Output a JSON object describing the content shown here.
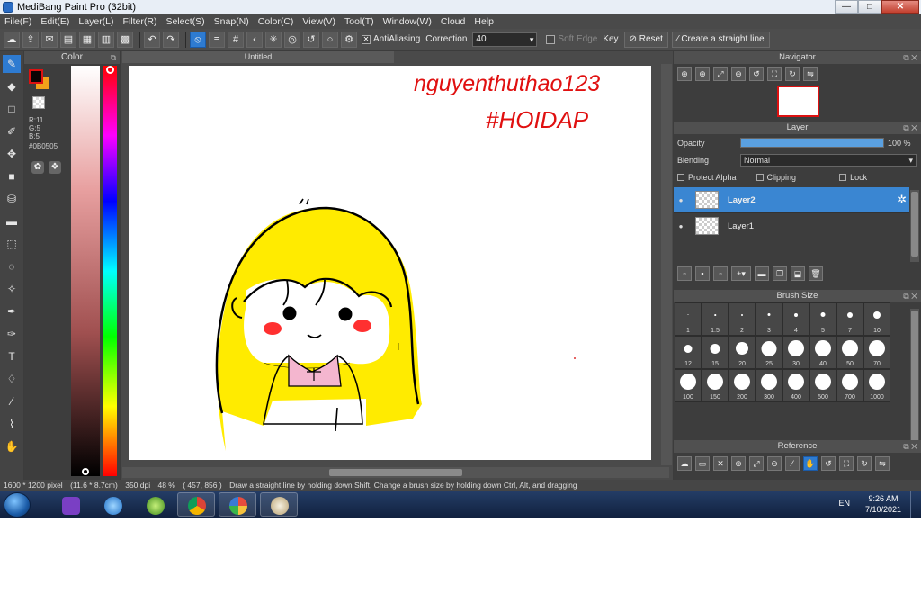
{
  "window": {
    "title": "MediBang Paint Pro (32bit)",
    "min": "—",
    "max": "□",
    "close": "✕"
  },
  "menu": [
    "File(F)",
    "Edit(E)",
    "Layer(L)",
    "Filter(R)",
    "Select(S)",
    "Snap(N)",
    "Color(C)",
    "View(V)",
    "Tool(T)",
    "Window(W)",
    "Cloud",
    "Help"
  ],
  "toolbar": {
    "antialiasing_label": "AntiAliasing",
    "correction_label": "Correction",
    "correction_value": "40",
    "soft_edge_label": "Soft Edge",
    "key_label": "Key",
    "reset_label": "Reset",
    "straight_line_label": "Create a straight line"
  },
  "color_panel": {
    "title": "Color",
    "r": "R:11",
    "g": "G:5",
    "b": "B:5",
    "hex": "#0B0505",
    "fg_color": "#0b0505",
    "bg_color": "#f2a21a"
  },
  "canvas": {
    "tab_title": "Untitled",
    "handwriting_line1": "nguyenthuthao123",
    "handwriting_line2": "#HOIDAP"
  },
  "navigator": {
    "title": "Navigator"
  },
  "layer_panel": {
    "title": "Layer",
    "opacity_label": "Opacity",
    "opacity_value": "100 %",
    "blending_label": "Blending",
    "blending_value": "Normal",
    "protect_alpha": "Protect Alpha",
    "clipping": "Clipping",
    "lock": "Lock",
    "layers": [
      {
        "name": "Layer2",
        "selected": true
      },
      {
        "name": "Layer1",
        "selected": false
      }
    ]
  },
  "brush_size": {
    "title": "Brush Size",
    "sizes": [
      "1",
      "1.5",
      "2",
      "3",
      "4",
      "5",
      "7",
      "10",
      "12",
      "15",
      "20",
      "25",
      "30",
      "40",
      "50",
      "70",
      "100",
      "150",
      "200",
      "300",
      "400",
      "500",
      "700",
      "1000"
    ]
  },
  "reference": {
    "title": "Reference"
  },
  "status": {
    "size": "1600 * 1200 pixel",
    "cm": "(11.6 * 8.7cm)",
    "dpi": "350 dpi",
    "zoom": "48 %",
    "coords": "( 457, 856 )",
    "hint": "Draw a straight line by holding down Shift, Change a brush size by holding down Ctrl, Alt, and dragging"
  },
  "taskbar": {
    "lang": "EN",
    "time": "9:26 AM",
    "date": "7/10/2021"
  }
}
